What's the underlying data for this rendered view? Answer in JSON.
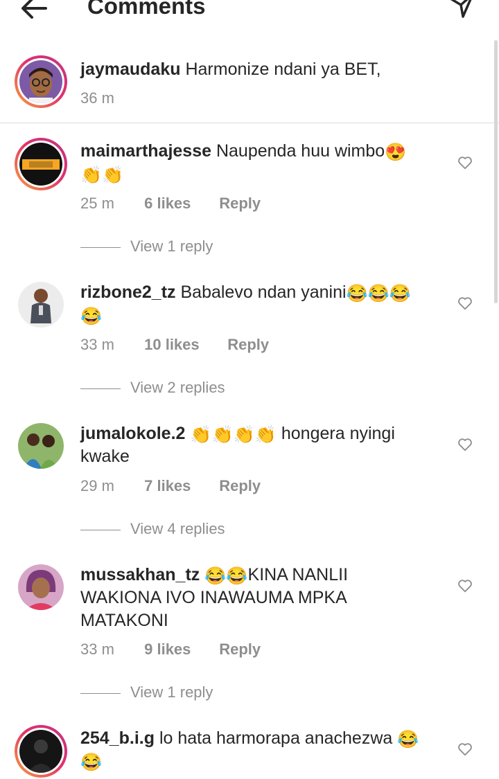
{
  "header": {
    "title": "Comments",
    "back_icon": "arrow-left-icon",
    "share_icon": "paper-plane-icon"
  },
  "caption": {
    "username": "jaymaudaku",
    "text": "Harmonize ndani ya BET,",
    "time": "36 m"
  },
  "comments": [
    {
      "username": "maimarthajesse",
      "text": "Naupenda huu wimbo",
      "emoji_after": "😍",
      "line2_emoji": "👏👏",
      "time": "25 m",
      "likes": "6 likes",
      "reply": "Reply",
      "view_replies": "View 1 reply"
    },
    {
      "username": "rizbone2_tz",
      "text": "Babalevo ndan yanini",
      "emoji_after": "😂😂😂",
      "line2_emoji": "😂",
      "time": "33 m",
      "likes": "10 likes",
      "reply": "Reply",
      "view_replies": "View 2 replies"
    },
    {
      "username": "jumalokole.2",
      "emoji_after": "👏👏👏👏",
      "text": "hongera nyingi",
      "line2": "kwake",
      "time": "29 m",
      "likes": "7 likes",
      "reply": "Reply",
      "view_replies": "View 4 replies"
    },
    {
      "username": "mussakhan_tz",
      "emoji_after": "😂😂",
      "text": "KINA NANLII",
      "line2": "WAKIONA IVO INAWAUMA MPKA",
      "line3": "MATAKONI",
      "time": "33 m",
      "likes": "9 likes",
      "reply": "Reply",
      "view_replies": "View 1 reply"
    },
    {
      "username": "254_b.i.g",
      "text": "lo hata harmorapa anachezwa",
      "emoji_after": "😂",
      "line2_emoji": "😂"
    }
  ],
  "colors": {
    "text": "#262626",
    "muted": "#8e8e8e",
    "divider": "#dbdbdb",
    "ring_start": "#f9a13a",
    "ring_end": "#c13584"
  }
}
